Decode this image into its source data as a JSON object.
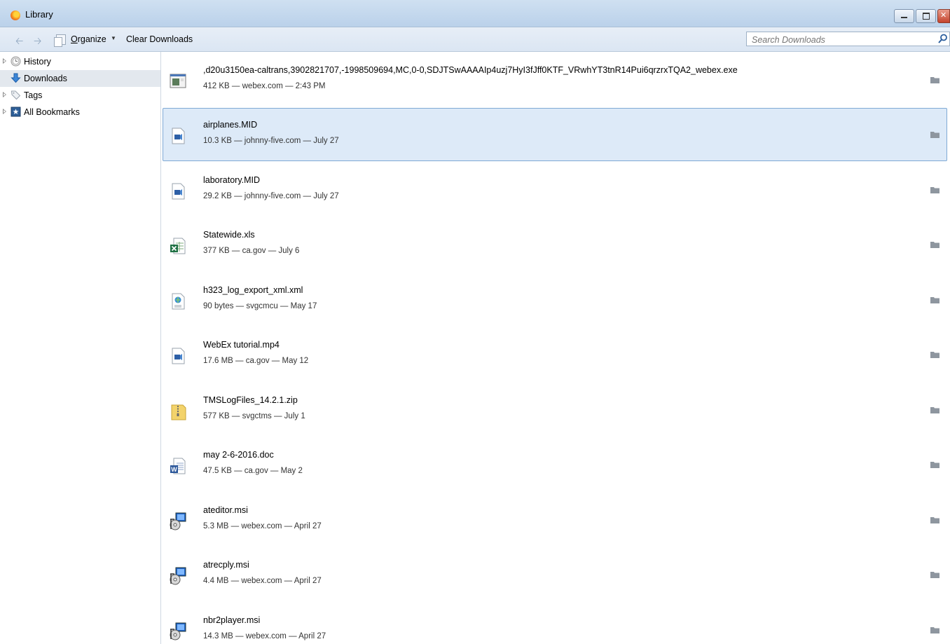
{
  "window": {
    "title": "Library"
  },
  "toolbar": {
    "organize_label": "Organize",
    "organize_accel": "O",
    "organize_rest": "rganize",
    "clear_label": "Clear Downloads",
    "search_placeholder": "Search Downloads"
  },
  "sidebar": {
    "items": [
      {
        "label": "History",
        "icon": "history-clock-icon",
        "expandable": true
      },
      {
        "label": "Downloads",
        "icon": "download-arrow-icon",
        "expandable": false,
        "selected": true
      },
      {
        "label": "Tags",
        "icon": "tag-icon",
        "expandable": true
      },
      {
        "label": "All Bookmarks",
        "icon": "bookmarks-star-icon",
        "expandable": true
      }
    ]
  },
  "downloads": [
    {
      "name": ",d20u3150ea-caltrans,3902821707,-1998509694,MC,0-0,SDJTSwAAAAIp4uzj7HyI3fJff0KTF_VRwhYT3tnR14Pui6qrzrxTQA2_webex.exe",
      "meta": "412 KB — webex.com — 2:43 PM",
      "icon": "exe-file-icon"
    },
    {
      "name": "airplanes.MID",
      "meta": "10.3 KB — johnny-five.com — July 27",
      "icon": "media-file-icon",
      "selected": true
    },
    {
      "name": "laboratory.MID",
      "meta": "29.2 KB — johnny-five.com — July 27",
      "icon": "media-file-icon"
    },
    {
      "name": "Statewide.xls",
      "meta": "377 KB — ca.gov — July 6",
      "icon": "excel-file-icon"
    },
    {
      "name": "h323_log_export_xml.xml",
      "meta": "90 bytes — svgcmcu — May 17",
      "icon": "xml-file-icon"
    },
    {
      "name": "WebEx tutorial.mp4",
      "meta": "17.6 MB — ca.gov — May 12",
      "icon": "media-file-icon"
    },
    {
      "name": "TMSLogFiles_14.2.1.zip",
      "meta": "577 KB — svgctms — July 1",
      "icon": "zip-folder-icon"
    },
    {
      "name": "may 2-6-2016.doc",
      "meta": "47.5 KB — ca.gov — May 2",
      "icon": "word-file-icon"
    },
    {
      "name": "ateditor.msi",
      "meta": "5.3 MB — webex.com — April 27",
      "icon": "installer-file-icon"
    },
    {
      "name": "atrecply.msi",
      "meta": "4.4 MB — webex.com — April 27",
      "icon": "installer-file-icon"
    },
    {
      "name": "nbr2player.msi",
      "meta": "14.3 MB — webex.com — April 27",
      "icon": "installer-file-icon"
    }
  ],
  "colors": {
    "selection_bg": "#ddeaf8",
    "selection_border": "#7fa9d5",
    "titlebar": "#c3d7ee"
  }
}
